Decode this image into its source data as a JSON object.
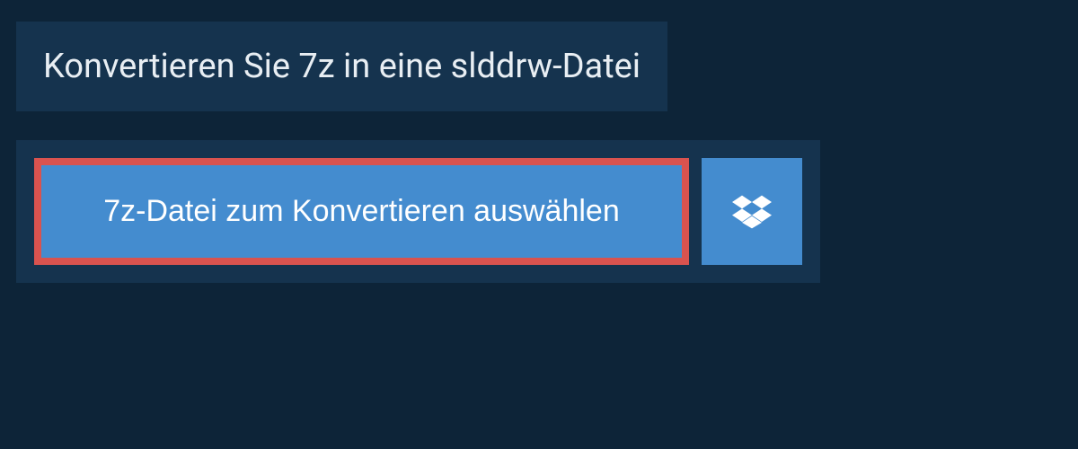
{
  "header": {
    "title": "Konvertieren Sie 7z in eine slddrw-Datei"
  },
  "actions": {
    "select_file_label": "7z-Datei zum Konvertieren auswählen",
    "dropbox_icon": "dropbox"
  }
}
